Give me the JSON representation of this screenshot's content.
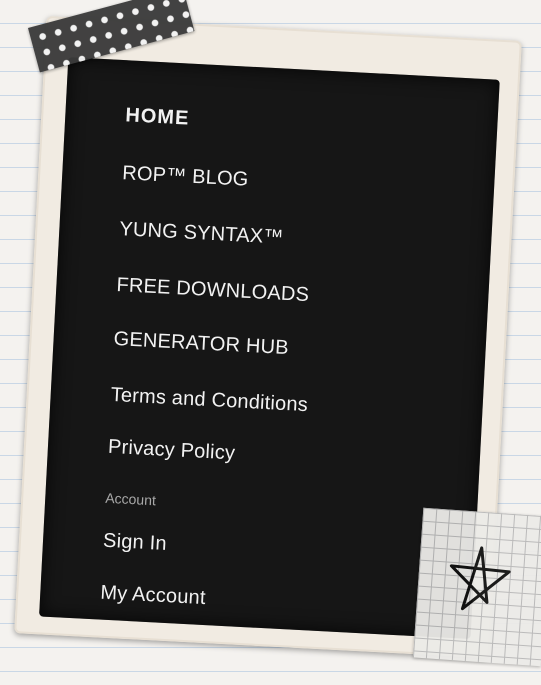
{
  "menu": {
    "items": [
      {
        "label": "HOME"
      },
      {
        "label": "ROP™ BLOG"
      },
      {
        "label": "YUNG SYNTAX™"
      },
      {
        "label": "FREE DOWNLOADS"
      },
      {
        "label": "GENERATOR HUB"
      },
      {
        "label": "Terms and Conditions"
      },
      {
        "label": "Privacy Policy"
      }
    ],
    "account_label": "Account",
    "account_items": [
      {
        "label": "Sign In"
      },
      {
        "label": "My Account"
      }
    ]
  },
  "decor": {
    "tape_icon": "polka-dot-tape",
    "star_icon": "star-icon",
    "panel_color": "#161616",
    "frame_color": "#f1ebe2"
  }
}
